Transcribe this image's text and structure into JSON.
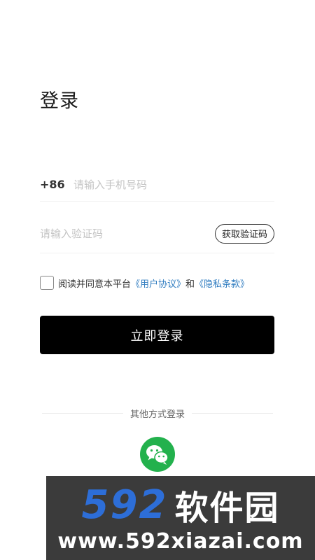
{
  "title": "登录",
  "phone": {
    "country_code": "+86",
    "placeholder": "请输入手机号码"
  },
  "code": {
    "placeholder": "请输入验证码",
    "get_code_label": "获取验证码"
  },
  "agreement": {
    "prefix": "阅读并同意本平台",
    "user_agreement": "《用户协议》",
    "and": "和",
    "privacy_policy": "《隐私条款》"
  },
  "login_label": "立即登录",
  "other_login_label": "其他方式登录",
  "icons": {
    "wechat": "wechat-icon"
  },
  "colors": {
    "primary_button": "#000000",
    "link": "#2f7cc0",
    "wechat": "#23b14d"
  },
  "watermark": {
    "number": "592",
    "name": "软件园",
    "url": "www.592xiazai.com"
  }
}
